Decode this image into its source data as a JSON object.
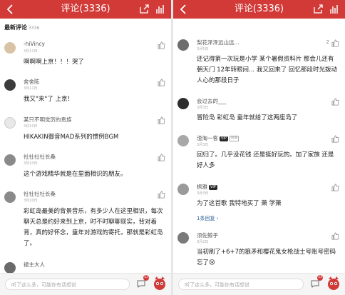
{
  "colors": {
    "accent": "#d23a38",
    "link": "#2f5e96"
  },
  "left": {
    "title": "评论(3336)",
    "section_title": "最新评论",
    "section_count": "3336",
    "comments": [
      {
        "name": "-hiVincy",
        "date": "3月11日",
        "text": "啊啊啊上京！！！哭了",
        "avatar_color": "#d9c3a5"
      },
      {
        "name": "舍舍陈",
        "date": "3月11日",
        "text": "我又\"来\"了 上京！",
        "avatar_color": "#3b3b3b"
      },
      {
        "name": "某只不明觉厉的贵族",
        "date": "3月10日",
        "text": "HIKAKIN御音MAD系列的惯例BGM",
        "avatar_color": "#e8e8e8"
      },
      {
        "name": "社社社社长桑",
        "date": "3月10日",
        "text": "这个游戏精华就是在里面相识的朋友。",
        "avatar_color": "#8a8a8a"
      },
      {
        "name": "社社社社长桑",
        "date": "3月10日",
        "text": "彩虹岛最美的背景音乐，有多少人在这里相识，每次聊天总是约好来到上京，时不时聊聊现实，背对着背，真的好怀念，童年对游戏的寄托，那就是彩虹岛了。",
        "avatar_color": "#8a8a8a"
      },
      {
        "name": "褪主大人",
        "date": "",
        "text": "",
        "avatar_color": "#6a6a6a"
      }
    ],
    "input_placeholder": "听了这么多，可能你有话想说",
    "bubble_count": "33"
  },
  "right": {
    "title": "评论(3336)",
    "comments": [
      {
        "name": "梨花泽泽远山远...",
        "date": "3月5日",
        "likes": "2",
        "text": "还记得第一次玩是小学 某个暑假资料片 那会儿还有朝天门 12年转眼间... 我又回来了 回忆那段时光拨动人心的那段日子",
        "avatar_color": "#6d6d6d",
        "badge": "",
        "tag": ""
      },
      {
        "name": "会过去的___",
        "date": "3月3日",
        "likes": "",
        "text": "冒险岛 彩虹岛 童年就给了这两座岛了",
        "avatar_color": "#2d2d2d",
        "badge": "",
        "tag": ""
      },
      {
        "name": "渣淘一客",
        "date": "3月3日",
        "likes": "",
        "text": "回归了。几乎没花钱 还是挺好玩的。加了家族 还是好人多",
        "avatar_color": "#a8a8a8",
        "badge": "VIP",
        "tag": "同城"
      },
      {
        "name": "枫雅",
        "date": "3月3日",
        "likes": "",
        "text": "为了这首歌 我特地买了 萧 学萧",
        "more": "1条回复 ›",
        "avatar_color": "#9a9a9a",
        "badge": "VIP",
        "tag": ""
      },
      {
        "name": "须佐鲸乎",
        "date": "3月2日",
        "likes": "",
        "text": "当初刷了+6+7的狼矛和樱花鬼女枪战士号账号密码忘了😢",
        "avatar_color": "#7a7a7a",
        "badge": "",
        "tag": ""
      }
    ],
    "input_placeholder": "听了这么多，可能你有话想说",
    "bubble_count": "33"
  },
  "icons": {
    "back": "back-arrow-icon",
    "share": "share-icon",
    "chart": "chart-icon",
    "like": "thumb-up-icon",
    "comment": "comment-bubble-icon",
    "mascot": "mascot-icon"
  }
}
